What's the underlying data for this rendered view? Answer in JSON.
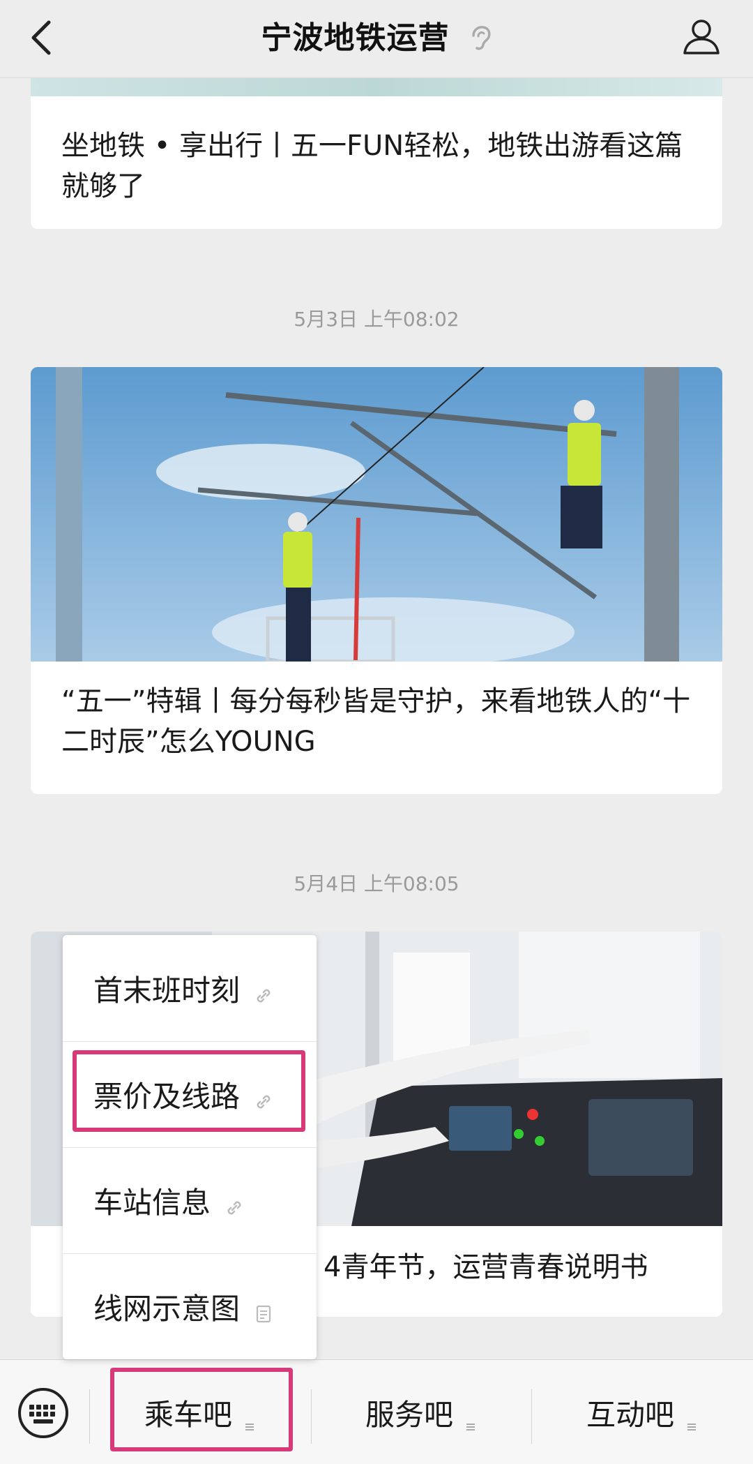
{
  "header": {
    "title": "宁波地铁运营"
  },
  "feed": {
    "card1": {
      "title": "坐地铁 • 享出行丨五一FUN轻松，地铁出游看这篇就够了"
    },
    "timestamp1": "5月3日 上午08:02",
    "card2": {
      "title": "“五一”特辑丨每分每秒皆是守护，来看地铁人的“十二时辰”怎么YOUNG"
    },
    "timestamp2": "5月4日 上午08:05",
    "card3": {
      "title_visible": "4青年节，运营青春说明书",
      "title_prefix": "“"
    }
  },
  "menu": {
    "items": [
      {
        "label": "首末班时刻",
        "icon": "link-icon"
      },
      {
        "label": "票价及线路",
        "icon": "link-icon"
      },
      {
        "label": "车站信息",
        "icon": "link-icon"
      },
      {
        "label": "线网示意图",
        "icon": "doc-icon"
      }
    ]
  },
  "bottom_bar": {
    "tabs": [
      {
        "label": "乘车吧"
      },
      {
        "label": "服务吧"
      },
      {
        "label": "互动吧"
      }
    ]
  },
  "colors": {
    "highlight": "#d63a79",
    "background": "#ededed"
  }
}
